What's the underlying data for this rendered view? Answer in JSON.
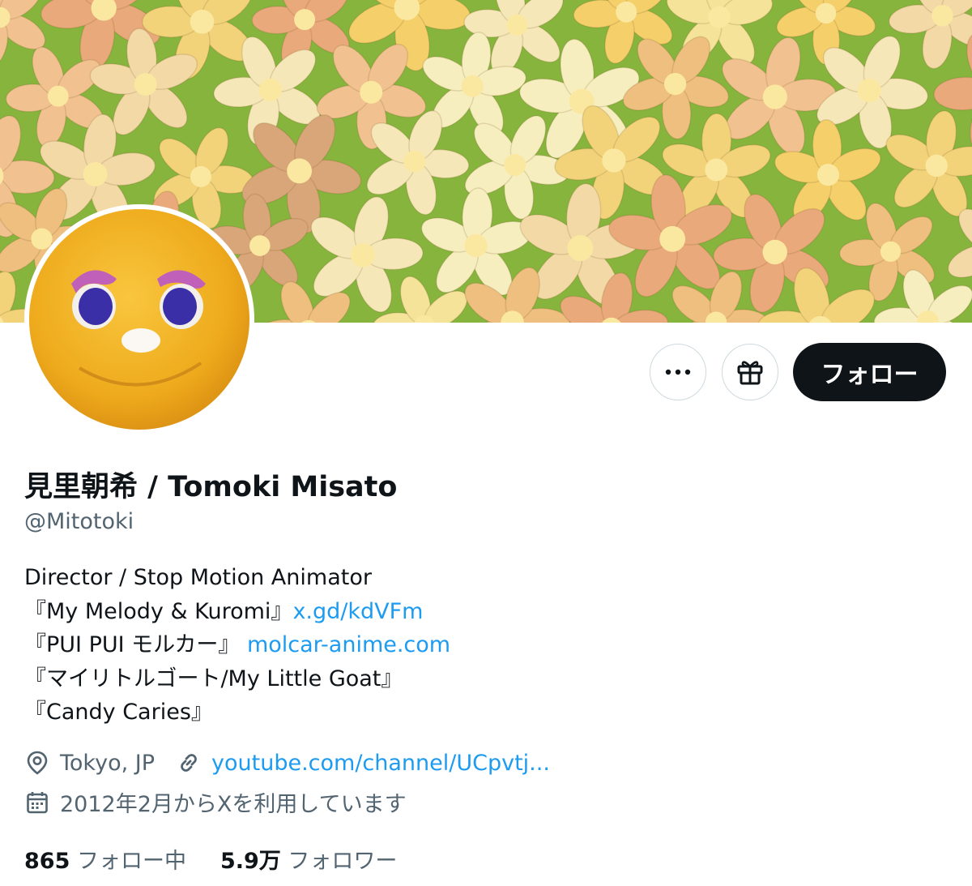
{
  "profile": {
    "display_name": "見里朝希 / Tomoki Misato",
    "handle": "@Mitotoki",
    "bio_lines": [
      {
        "text": "Director / Stop Motion Animator",
        "link": ""
      },
      {
        "text": "『My Melody & Kuromi』",
        "link": "x.gd/kdVFm"
      },
      {
        "text": "『PUI PUI モルカー』 ",
        "link": "molcar-anime.com"
      },
      {
        "text": "『マイリトルゴート/My Little Goat』",
        "link": ""
      },
      {
        "text": "『Candy Caries』",
        "link": ""
      }
    ],
    "location": "Tokyo, JP",
    "website": "youtube.com/channel/UCpvtj...",
    "joined": "2012年2月からXを利用しています",
    "following_count": "865",
    "following_label": "フォロー中",
    "followers_count": "5.9万",
    "followers_label": "フォロワー"
  },
  "actions": {
    "more_icon": "ellipsis-icon",
    "gift_icon": "gift-icon",
    "follow_label": "フォロー"
  },
  "colors": {
    "link": "#1d9bf0",
    "secondary_text": "#536471",
    "primary_text": "#0f1419",
    "follow_button_bg": "#0f1419"
  }
}
